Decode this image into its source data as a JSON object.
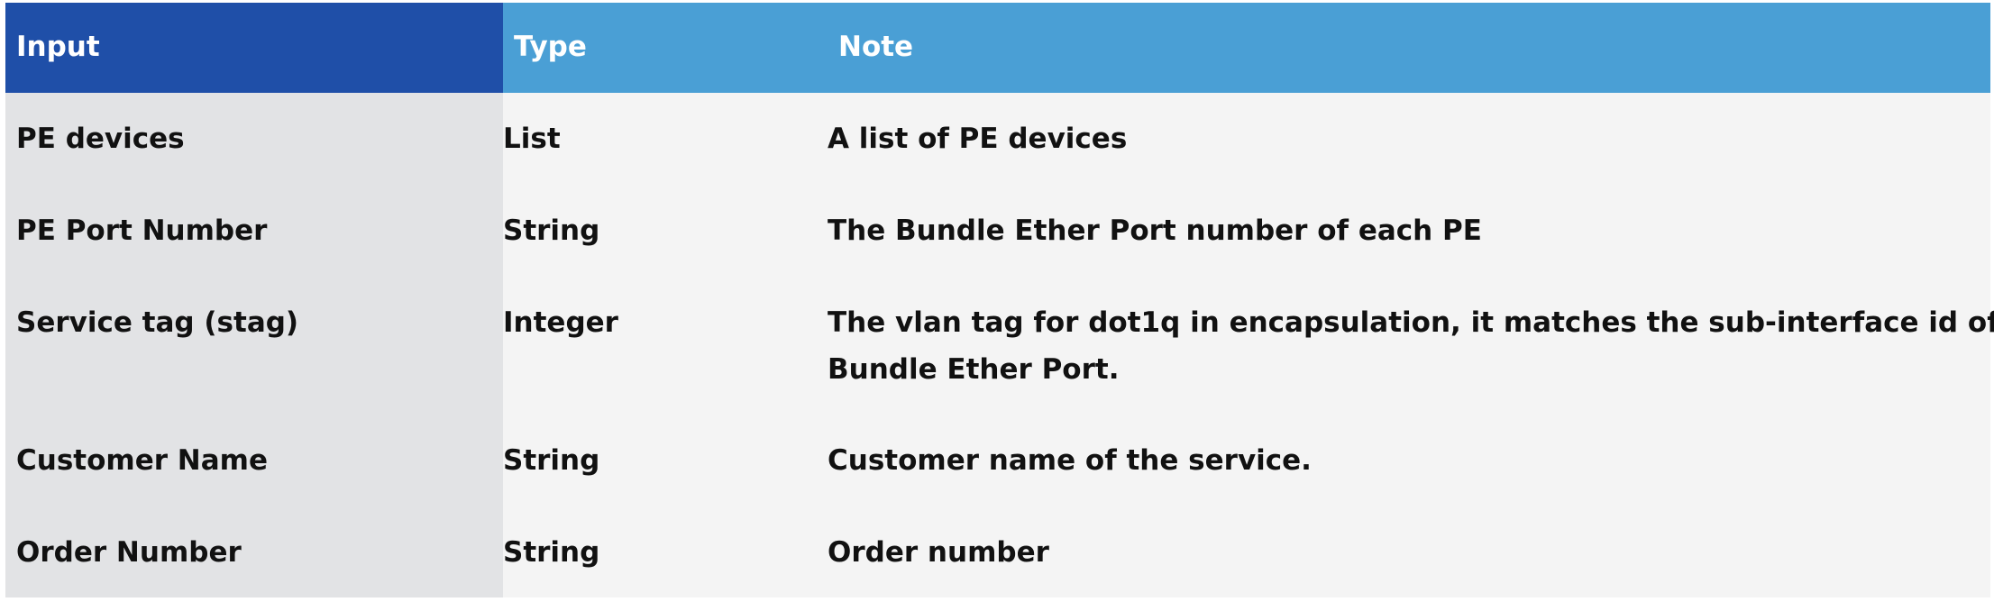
{
  "table": {
    "headers": {
      "input": "Input",
      "type": "Type",
      "note": "Note"
    },
    "rows": [
      {
        "input": "PE devices",
        "type": "List",
        "note": "A list of PE devices"
      },
      {
        "input": "PE Port Number",
        "type": "String",
        "note": "The Bundle Ether Port number of each PE"
      },
      {
        "input": "Service tag (stag)",
        "type": "Integer",
        "note_line1": "The vlan tag for dot1q in encapsulation, it matches the sub-interface id of",
        "note_line2": "Bundle Ether Port."
      },
      {
        "input": "Customer Name",
        "type": "String",
        "note": "Customer name of the service."
      },
      {
        "input": "Order Number",
        "type": "String",
        "note": "Order number"
      }
    ]
  },
  "colors": {
    "header_input_bg": "#1f4fa8",
    "header_bg": "#4a9fd5",
    "input_col_bg": "#e2e3e5",
    "body_bg": "#f4f4f4"
  }
}
